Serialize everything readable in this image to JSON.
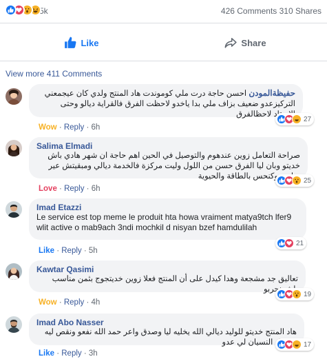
{
  "post_stats": {
    "reaction_count": "5k",
    "comments_shares": "426 Comments 310 Shares",
    "reactions": [
      "like",
      "love",
      "wow",
      "haha"
    ]
  },
  "actions": {
    "like_label": "Like",
    "share_label": "Share"
  },
  "view_more": "View more 411 Comments",
  "colors": {
    "accent": "#1877f2",
    "link": "#385898",
    "love": "#e4405f",
    "wow": "#f7b125",
    "muted": "#606770",
    "bubble_bg": "#f2f3f5"
  },
  "comments": [
    {
      "author": "حفيظةالمودن",
      "text": "احسن حاجة درت ملي كوموندت هاد المنتج ولدي كان عيجمعني التركيزعدو ضعيف بزاف ملي بدا ياخدو لاحظت الفرق فالقراية ديالو وحتى الاستاد لاحظالفرق",
      "reaction_label": "Wow",
      "reply": "Reply",
      "time": "6h",
      "reaction_count": "27",
      "icons": [
        "like",
        "love",
        "haha"
      ]
    },
    {
      "author": "Salima Elmadi",
      "text": "صراحة التعامل زوين عندهوم والتوصيل في الحين اهم حاجة ان شهر هادي باش خديتو وبان ليا الفرق حسن من اللول وليت مركزة فالخدمة ديالي ومبقيتش عير ساهية وكنحس بالطاقة والحيوية",
      "reaction_label": "Love",
      "reply": "Reply",
      "time": "6h",
      "reaction_count": "25",
      "icons": [
        "like",
        "love",
        "wow"
      ]
    },
    {
      "author": "Imad Etazzi",
      "text": "Le service est top meme le produit hta howa vraiment matya9tch lfer9 wlit active o mab9ach 3ndi mochkil d nisyan bzef hamdulilah",
      "reaction_label": "Like",
      "reply": "Reply",
      "time": "5h",
      "reaction_count": "21",
      "icons": [
        "like",
        "love"
      ]
    },
    {
      "author": "Kawtar Qasimi",
      "text": "تعاليق جد مشجعة وهدا كيدل على أن المنتج فعلا زوين خديتجوج بثمن مناسب باش نجربو",
      "reaction_label": "Wow",
      "reply": "Reply",
      "time": "4h",
      "reaction_count": "19",
      "icons": [
        "like",
        "love",
        "wow"
      ]
    },
    {
      "author": "Imad Abo Nasser",
      "text": "هاد المنتج خديتو للوليد ديالي الله يخليه ليا وصدق واعر حمد الله نفعو ونقص ليه مشكل النسيان لي عدو",
      "reaction_label": "Like",
      "reply": "Reply",
      "time": "3h",
      "reaction_count": "17",
      "icons": [
        "like",
        "love",
        "haha"
      ]
    }
  ]
}
